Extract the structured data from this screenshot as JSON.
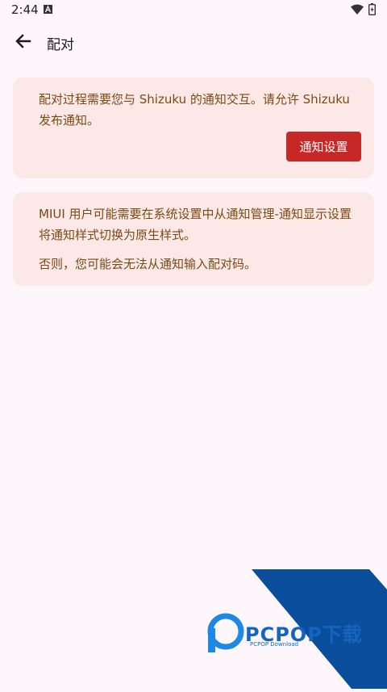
{
  "status": {
    "time": "2:44"
  },
  "appbar": {
    "title": "配对"
  },
  "card1": {
    "text": "配对过程需要您与 Shizuku 的通知交互。请允许 Shizuku 发布通知。",
    "button_label": "通知设置"
  },
  "card2": {
    "paragraph1": "MIUI 用户可能需要在系统设置中从通知管理-通知显示设置将通知样式切换为原生样式。",
    "paragraph2": "否则，您可能会无法从通知输入配对码。"
  },
  "watermark": {
    "brand": "PCPOP下载",
    "sub": "PCPOP Download"
  },
  "colors": {
    "background": "#fdf7fc",
    "card": "#fce8e6",
    "card_text": "#7a4a14",
    "button": "#c62828",
    "watermark_blue": "#1565c0"
  },
  "icons": {
    "back": "arrow-left-icon",
    "notification": "a-notification-icon",
    "wifi": "wifi-icon",
    "battery": "battery-icon"
  }
}
